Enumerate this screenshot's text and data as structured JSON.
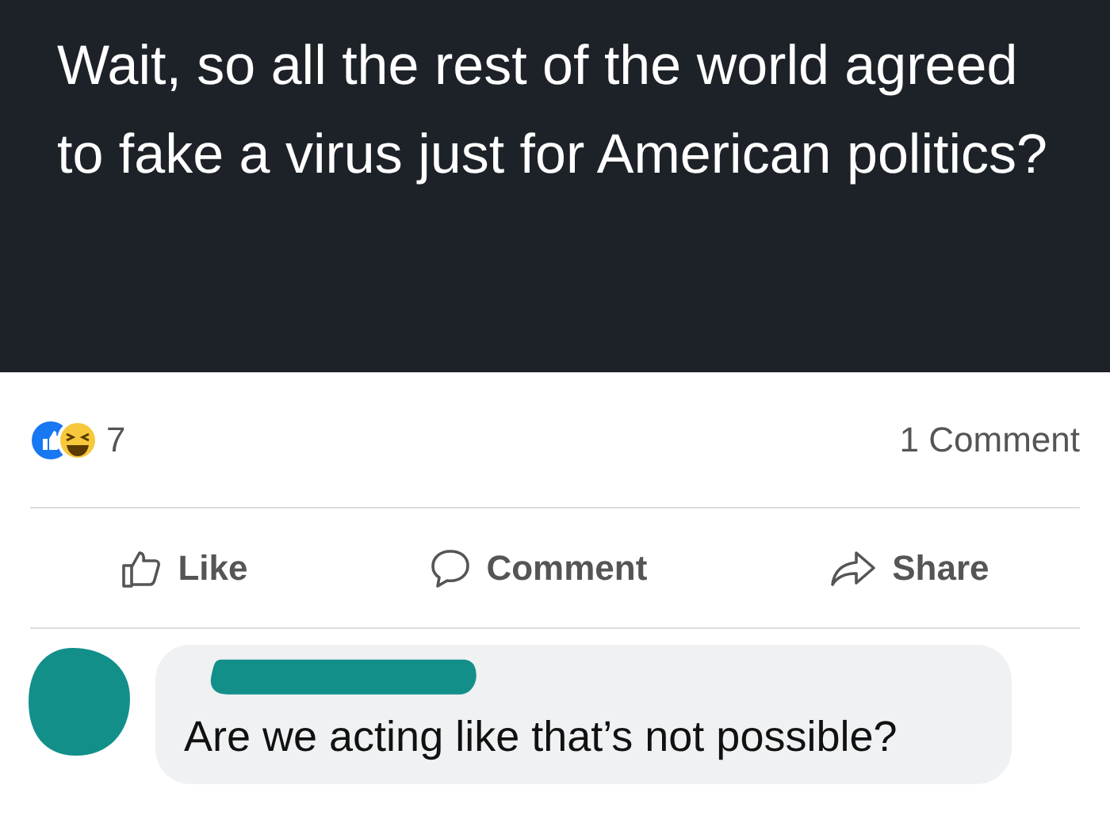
{
  "post": {
    "text": "Wait, so all the rest of the world agreed to fake a virus just for American politics?"
  },
  "reactions": {
    "count": "7",
    "comments": "1 Comment"
  },
  "actions": [
    {
      "kind": "like",
      "label": "Like"
    },
    {
      "kind": "comment",
      "label": "Comment"
    },
    {
      "kind": "share",
      "label": "Share"
    }
  ],
  "comment": {
    "text": "Are we acting like that’s not possible?"
  }
}
